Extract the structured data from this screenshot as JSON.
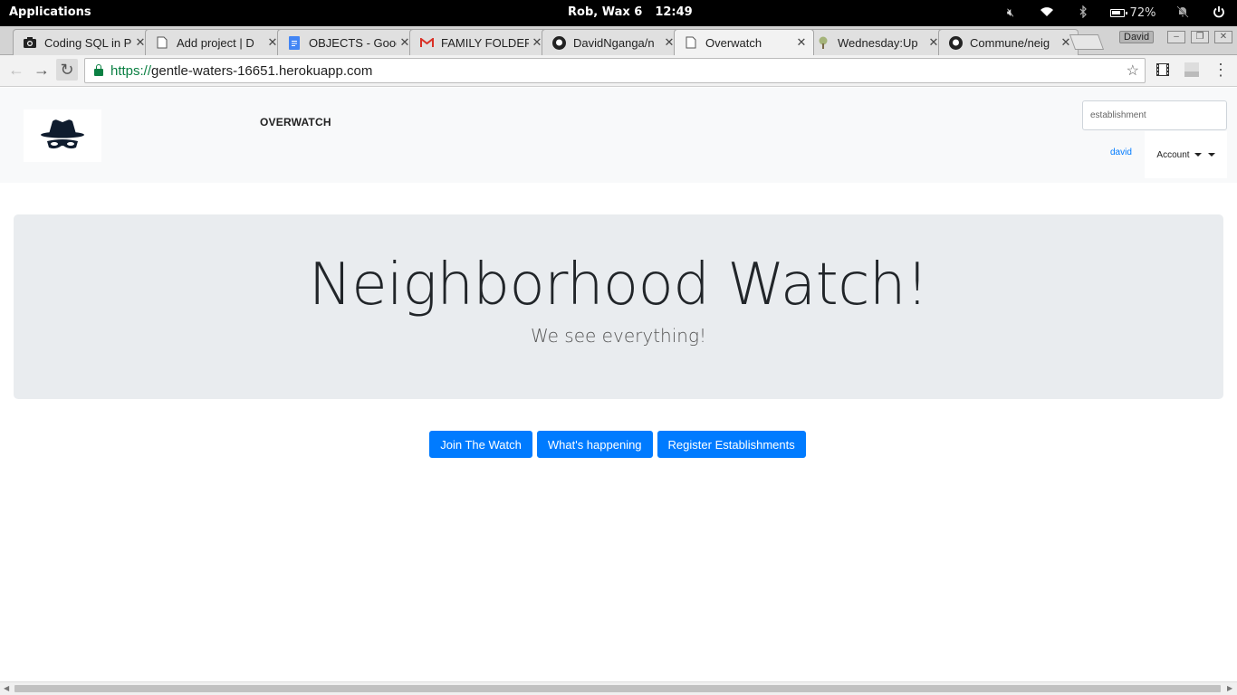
{
  "os": {
    "apps_label": "Applications",
    "date": "Rob, Wax  6",
    "time": "12:49",
    "battery": "72%"
  },
  "tabs": [
    {
      "title": "Coding SQL in P",
      "icon": "camera-icon"
    },
    {
      "title": "Add project | D",
      "icon": "document-icon"
    },
    {
      "title": "OBJECTS - Goog",
      "icon": "google-docs-icon"
    },
    {
      "title": "FAMILY FOLDER",
      "icon": "gmail-icon"
    },
    {
      "title": "DavidNganga/n",
      "icon": "github-icon"
    },
    {
      "title": "Overwatch",
      "icon": "document-icon",
      "active": true
    },
    {
      "title": "Wednesday:Up",
      "icon": "tree-icon"
    },
    {
      "title": "Commune/neig",
      "icon": "github-icon"
    }
  ],
  "profile_name": "David",
  "address": {
    "scheme": "https://",
    "host": "gentle-waters-16651.herokuapp.com"
  },
  "site": {
    "brand": "OVERWATCH",
    "search_placeholder": "establishment",
    "user": "david",
    "account_label": "Account"
  },
  "hero": {
    "title": "Neighborhood Watch!",
    "lead": "We see everything!"
  },
  "buttons": {
    "join": "Join The Watch",
    "happening": "What's happening",
    "register": "Register Establishments"
  },
  "colors": {
    "primary": "#007bff",
    "navbar_bg": "#f8f9fa",
    "jumbotron_bg": "#e9ecef"
  }
}
